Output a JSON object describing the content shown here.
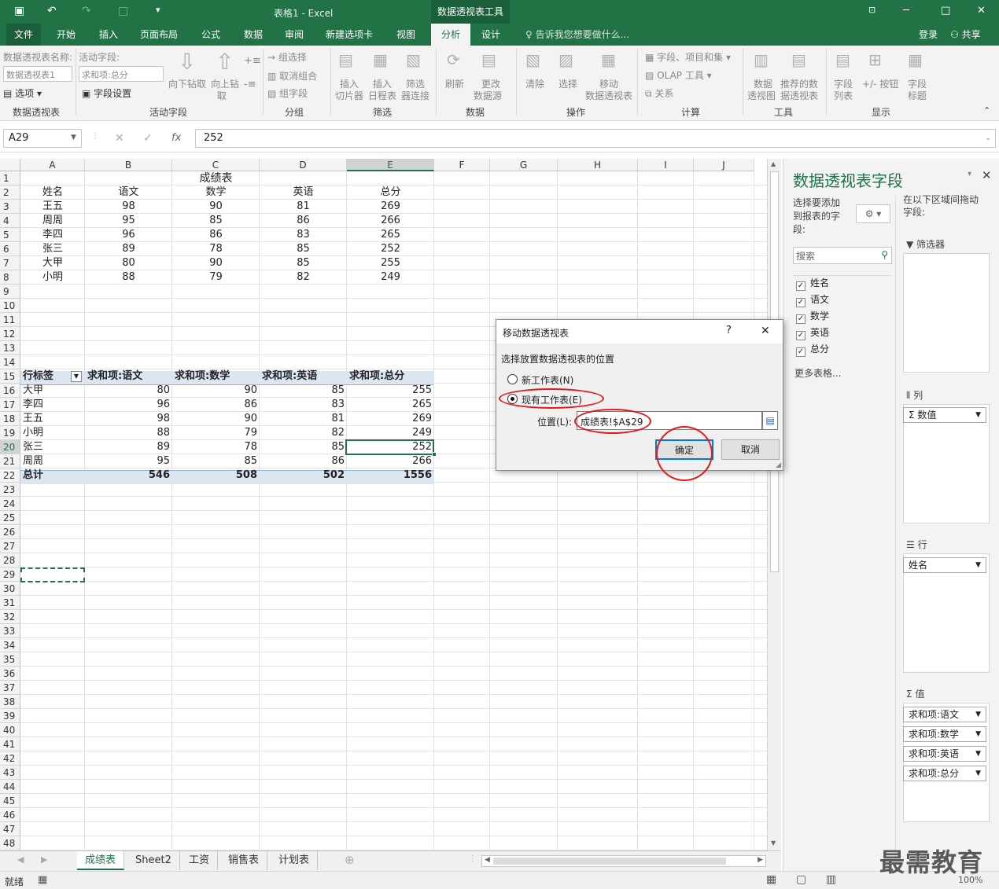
{
  "titlebar": {
    "app_title": "表格1 - Excel",
    "tool_tab": "数据透视表工具",
    "undo": "↶",
    "redo": "↷"
  },
  "tabs": [
    "文件",
    "开始",
    "插入",
    "页面布局",
    "公式",
    "数据",
    "审阅",
    "新建选项卡",
    "视图",
    "分析",
    "设计"
  ],
  "tellme": "告诉我您想要做什么...",
  "login": "登录",
  "share": "共享",
  "ribbon": {
    "pivot_name_label": "数据透视表名称:",
    "pivot_name_value": "数据透视表1",
    "options": "选项",
    "group_pivot": "数据透视表",
    "active_field_label": "活动字段:",
    "active_field_value": "求和项:总分",
    "field_settings": "字段设置",
    "drill_down": "向下钻取",
    "drill_up_1": "向上钻",
    "drill_up_2": "取",
    "group_active": "活动字段",
    "grp_select": "组选择",
    "ungroup": "取消组合",
    "grp_field": "组字段",
    "group_group": "分组",
    "slicer_1": "插入",
    "slicer_2": "切片器",
    "timeline_1": "插入",
    "timeline_2": "日程表",
    "filter_1": "筛选",
    "filter_2": "器连接",
    "group_filter": "筛选",
    "refresh": "刷新",
    "change_1": "更改",
    "change_2": "数据源",
    "group_data": "数据",
    "clear": "清除",
    "select": "选择",
    "move_1": "移动",
    "move_2": "数据透视表",
    "group_action": "操作",
    "fields_items": "字段、项目和集",
    "olap": "OLAP 工具",
    "relations": "关系",
    "group_calc": "计算",
    "chart_1": "数据",
    "chart_2": "透视图",
    "rec_1": "推荐的数",
    "rec_2": "据透视表",
    "group_tools": "工具",
    "fl_1": "字段",
    "fl_2": "列表",
    "pm_btn": "+/- 按钮",
    "fh_1": "字段",
    "fh_2": "标题",
    "group_show": "显示"
  },
  "formula_bar": {
    "namebox": "A29",
    "fx": "fx",
    "cancel": "✕",
    "enter": "✓",
    "value": "252"
  },
  "columns": [
    "A",
    "B",
    "C",
    "D",
    "E",
    "F",
    "G",
    "H",
    "I",
    "J"
  ],
  "rows": [
    "1",
    "2",
    "3",
    "4",
    "5",
    "6",
    "7",
    "8",
    "9",
    "10",
    "11",
    "12",
    "13",
    "14",
    "15",
    "16",
    "17",
    "18",
    "19",
    "20",
    "21",
    "22",
    "23",
    "24",
    "25",
    "26",
    "27",
    "28",
    "29",
    "30",
    "31",
    "32",
    "33",
    "34",
    "35",
    "36",
    "37",
    "38",
    "39",
    "40",
    "41",
    "42",
    "43",
    "44",
    "45",
    "46",
    "47",
    "48"
  ],
  "table": {
    "title": "成绩表",
    "header": [
      "姓名",
      "语文",
      "数学",
      "英语",
      "总分"
    ],
    "rows": [
      [
        "王五",
        "98",
        "90",
        "81",
        "269"
      ],
      [
        "周周",
        "95",
        "85",
        "86",
        "266"
      ],
      [
        "李四",
        "96",
        "86",
        "83",
        "265"
      ],
      [
        "张三",
        "89",
        "78",
        "85",
        "252"
      ],
      [
        "大甲",
        "80",
        "90",
        "85",
        "255"
      ],
      [
        "小明",
        "88",
        "79",
        "82",
        "249"
      ]
    ]
  },
  "pivot": {
    "header": [
      "行标签",
      "求和项:语文",
      "求和项:数学",
      "求和项:英语",
      "求和项:总分"
    ],
    "rows": [
      [
        "大甲",
        "80",
        "90",
        "85",
        "255"
      ],
      [
        "李四",
        "96",
        "86",
        "83",
        "265"
      ],
      [
        "王五",
        "98",
        "90",
        "81",
        "269"
      ],
      [
        "小明",
        "88",
        "79",
        "82",
        "249"
      ],
      [
        "张三",
        "89",
        "78",
        "85",
        "252"
      ],
      [
        "周周",
        "95",
        "85",
        "86",
        "266"
      ]
    ],
    "total": [
      "总计",
      "546",
      "508",
      "502",
      "1556"
    ]
  },
  "sheets": [
    "成绩表",
    "Sheet2",
    "工资",
    "销售表",
    "计划表"
  ],
  "panel": {
    "title": "数据透视表字段",
    "choose": [
      "选择要添加",
      "到报表的字",
      "段:"
    ],
    "drag": [
      "在以下区域间拖动",
      "字段:"
    ],
    "search_placeholder": "搜索",
    "fields": [
      "姓名",
      "语文",
      "数学",
      "英语",
      "总分"
    ],
    "more": "更多表格...",
    "filter_label": "筛选器",
    "cols_label": "列",
    "rows_label": "行",
    "values_label": "值",
    "col_item": "Σ 数值",
    "row_item": "姓名",
    "value_items": [
      "求和项:语文",
      "求和项:数学",
      "求和项:英语",
      "求和项:总分"
    ]
  },
  "dialog": {
    "title": "移动数据透视表",
    "help": "?",
    "close": "✕",
    "prompt": "选择放置数据透视表的位置",
    "opt_new": "新工作表(N)",
    "opt_existing": "现有工作表(E)",
    "location_label": "位置(L):",
    "location_value": "成绩表!$A$29",
    "ok": "确定",
    "cancel": "取消"
  },
  "status": {
    "ready": "就绪",
    "zoom": "100%"
  },
  "watermark": "最需教育",
  "colors": {
    "excel_green": "#217346",
    "annotation_red": "#e01b1b"
  }
}
